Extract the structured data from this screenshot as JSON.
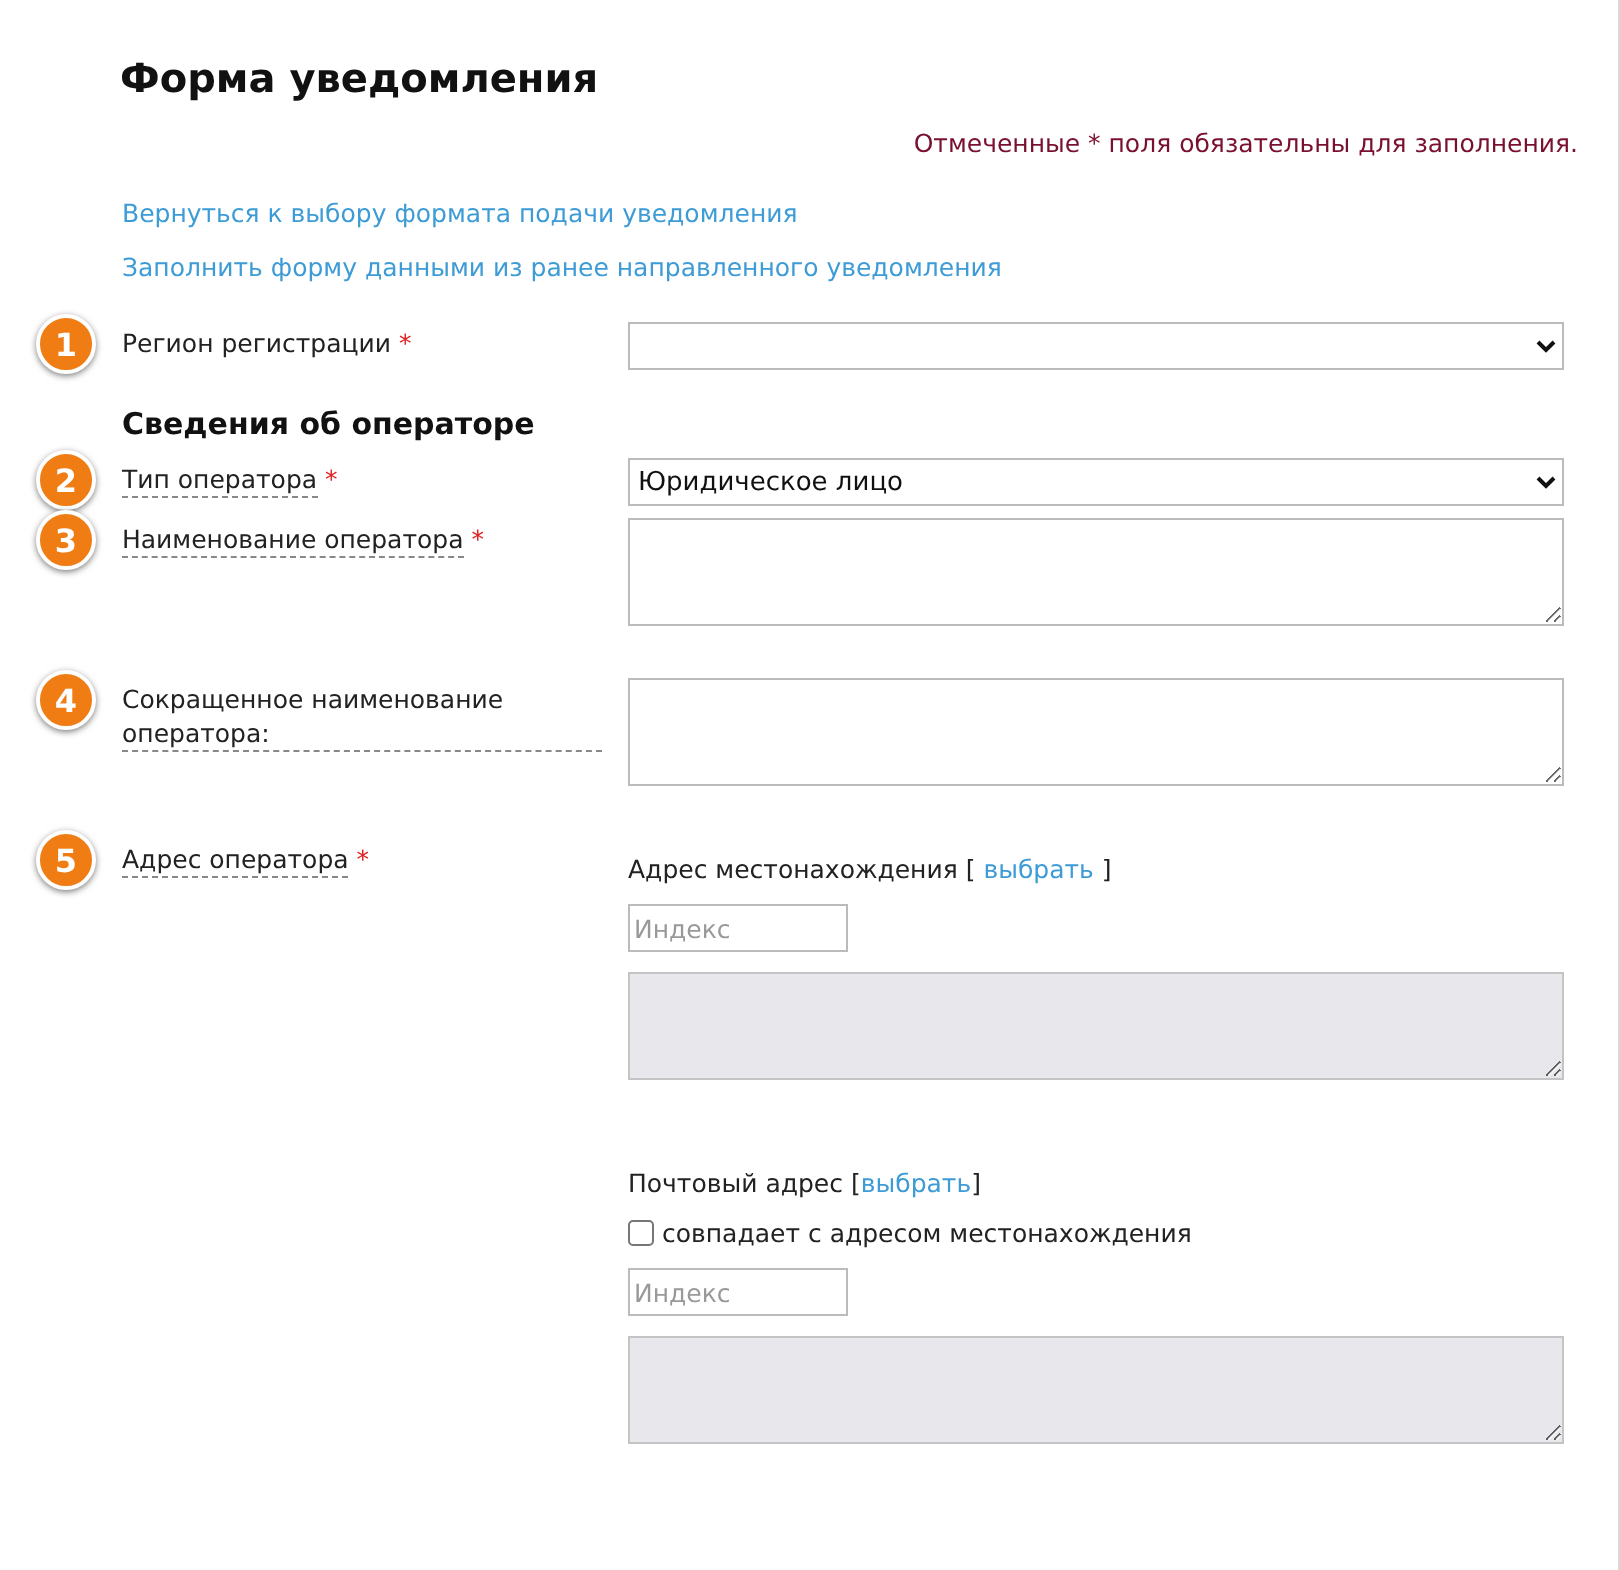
{
  "title": "Форма уведомления",
  "required_note": "Отмеченные * поля обязательны для заполнения.",
  "links": [
    "Вернуться к выбору формата подачи уведомления",
    "Заполнить форму данными из ранее направленного уведомления"
  ],
  "rows": [
    {
      "kind": "select",
      "badge": "1",
      "label": "Регион регистрации",
      "required_mark": "*",
      "dotted": false
    },
    {
      "kind": "heading",
      "text": "Сведения об операторе"
    },
    {
      "kind": "select",
      "badge": "2",
      "label": "Тип оператора",
      "required_mark": "*",
      "dotted": true,
      "value": "Юридическое лицо"
    },
    {
      "kind": "textarea",
      "badge": "3",
      "label": "Наименование оператора",
      "required_mark": "*",
      "dotted": true
    },
    {
      "kind": "textarea",
      "badge": "4",
      "label": "Сокращенное наименование оператора:",
      "dotted": true
    },
    {
      "kind": "address",
      "badge": "5",
      "label": "Адрес оператора",
      "required_mark": "*",
      "dotted": true,
      "blocks": [
        {
          "label": "Адрес местонахождения",
          "open": "[",
          "link": "выбрать",
          "close": "]",
          "spaced": true,
          "index_placeholder": "Индекс",
          "disabled": true
        },
        {
          "label": "Почтовый адрес",
          "open": "[",
          "link": "выбрать",
          "close": "]",
          "spaced": false,
          "checkbox": {
            "label": "совпадает с адресом местонахождения",
            "checked": false
          },
          "index_placeholder": "Индекс",
          "disabled": true
        }
      ]
    }
  ]
}
